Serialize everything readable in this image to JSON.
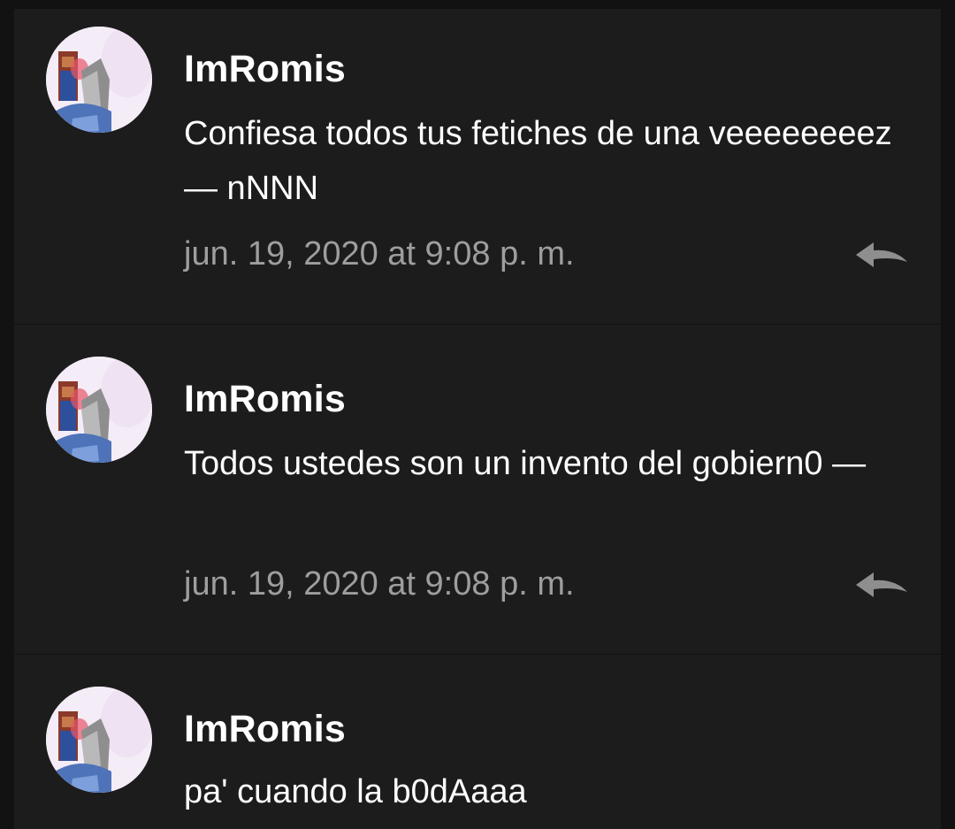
{
  "comments": [
    {
      "username": "ImRomis",
      "message": "Confiesa todos tus fetiches de una veeeeeeeez— nNNN",
      "timestamp": "jun. 19, 2020 at 9:08 p. m.",
      "icons": {
        "avatar": "user-avatar",
        "reply": "reply-arrow-icon"
      }
    },
    {
      "username": "ImRomis",
      "message": "Todos ustedes son un invento del gobiern0 —",
      "timestamp": "jun. 19, 2020 at 9:08 p. m.",
      "icons": {
        "avatar": "user-avatar",
        "reply": "reply-arrow-icon"
      }
    },
    {
      "username": "ImRomis",
      "message": "pa' cuando la b0dAaaa",
      "icons": {
        "avatar": "user-avatar"
      }
    }
  ],
  "colors": {
    "background": "#121212",
    "card": "#1c1c1c",
    "text_primary": "#ffffff",
    "text_secondary": "#9e9e9e"
  }
}
